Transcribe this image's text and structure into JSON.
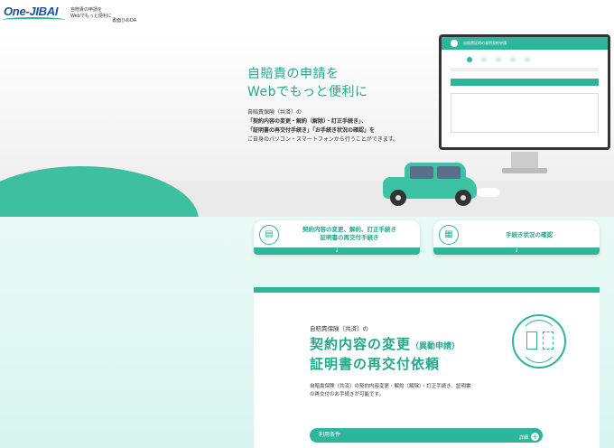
{
  "header": {
    "logo_text": "One-JIBAI",
    "tagline_line1": "自賠責の申請を",
    "tagline_line2": "Webでもっと便利に",
    "tagline_line3": "書面ひめDA"
  },
  "hero": {
    "title_line1": "自賠責の申請を",
    "title_line2": "Webでもっと便利に",
    "desc_line1": "自賠責保険（共済）の",
    "desc_line2": "「契約内容の変更・解約（解除）・訂正手続き」、",
    "desc_line3": "「証明書の再交付手続き」「お手続き状況の確認」を",
    "desc_line4": "ご自身のパソコン・スマートフォンから行うことができます。",
    "monitor_title": "自賠責証明の発明契約申請"
  },
  "nav": {
    "card1_line1": "契約内容の変更、解約、訂正手続き",
    "card1_line2": "証明書の再交付手続き",
    "card2_label": "手続き状況の確認",
    "arrow": "↓"
  },
  "main": {
    "subtitle": "自賠責保険（共済）の",
    "title1": "契約内容の変更",
    "title1_paren": "（異動申請）",
    "title2": "証明書の再交付依頼",
    "desc_line1": "自賠責保険（共済）の契約内容変更・解約（解除）・訂正手続き、証明書",
    "desc_line2": "の再交付のお手続きが可能です。",
    "btn1_label": "利用条件",
    "btn1_right": "詳細",
    "btn1_plus": "+"
  },
  "colors": {
    "accent": "#2fb59a",
    "accent_text": "#22a98a",
    "logo": "#1f4fa0"
  }
}
